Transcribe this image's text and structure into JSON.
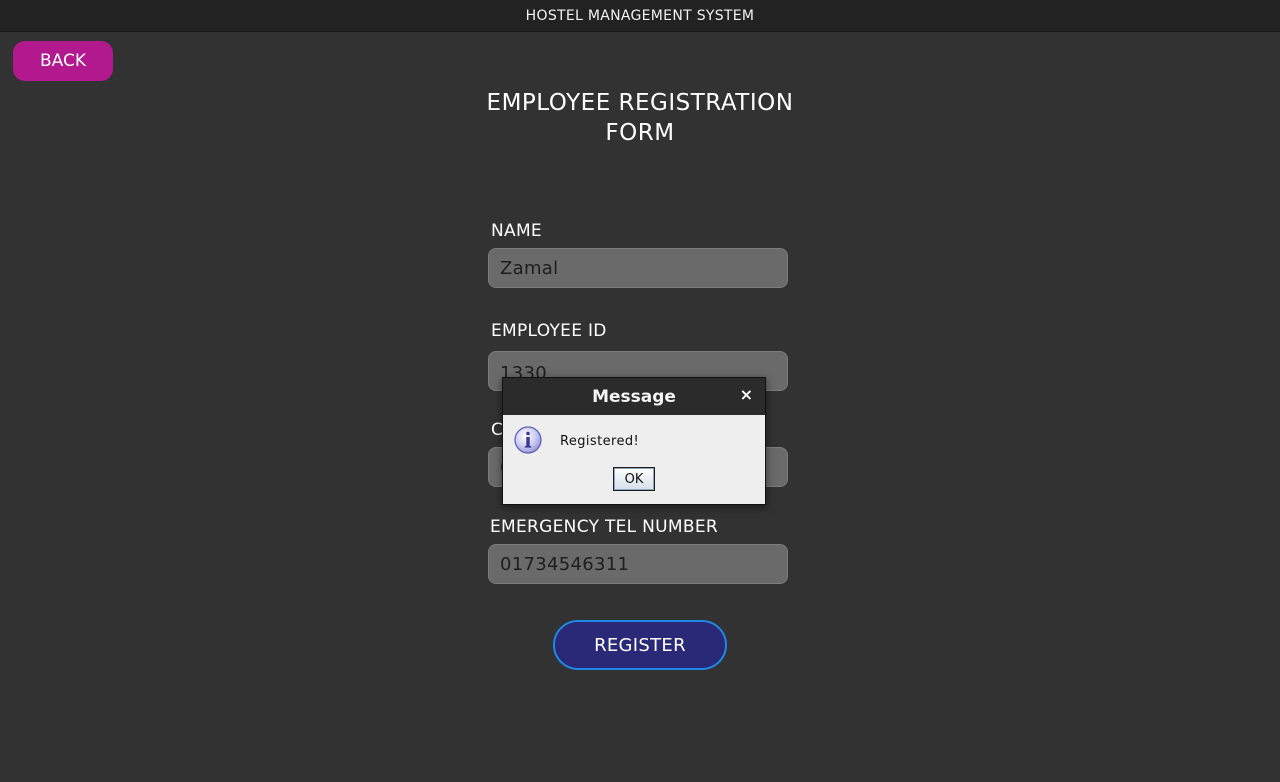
{
  "window": {
    "title": "HOSTEL MANAGEMENT SYSTEM"
  },
  "nav": {
    "back_label": "BACK"
  },
  "form": {
    "title_line1": "EMPLOYEE REGISTRATION",
    "title_line2": "FORM",
    "fields": [
      {
        "label": "NAME",
        "value": "Zamal"
      },
      {
        "label": "EMPLOYEE ID",
        "value": "1330"
      },
      {
        "label": "C",
        "value": "0"
      },
      {
        "label": "EMERGENCY TEL NUMBER",
        "value": "01734546311"
      }
    ],
    "register_label": "REGISTER"
  },
  "dialog": {
    "title": "Message",
    "close_glyph": "×",
    "message": "Registered!",
    "ok_label": "OK",
    "icon": "info-icon"
  },
  "colors": {
    "background": "#323232",
    "back_button": "#b3198f",
    "register_button": "#292978",
    "register_border": "#1e88e5"
  }
}
